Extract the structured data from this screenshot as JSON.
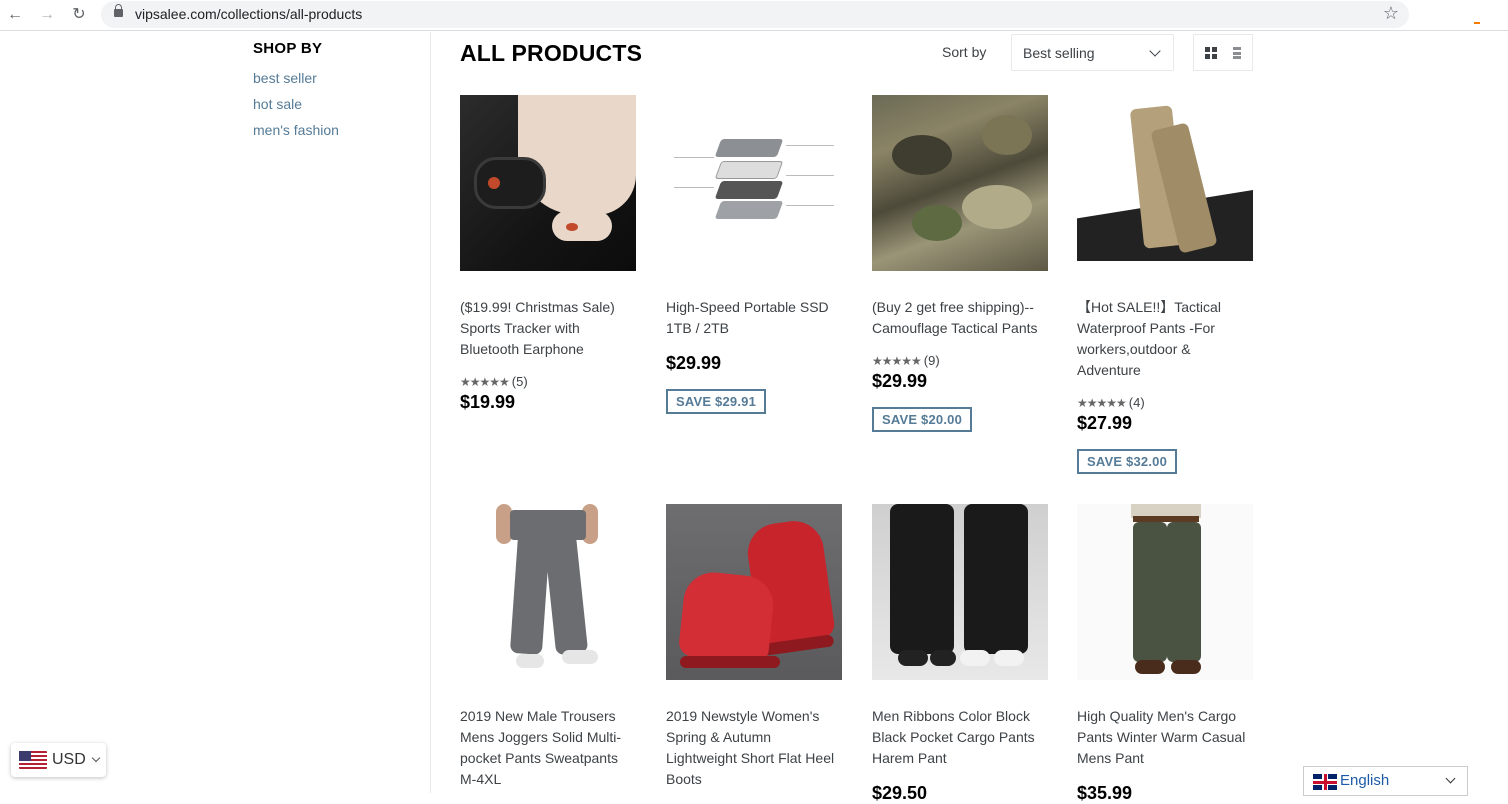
{
  "browser": {
    "url": "vipsalee.com/collections/all-products"
  },
  "sidebar": {
    "title": "SHOP BY",
    "links": [
      "best seller",
      "hot sale",
      "men's fashion"
    ]
  },
  "collection": {
    "title": "ALL PRODUCTS",
    "sort_label": "Sort by",
    "sort_value": "Best selling"
  },
  "products": [
    {
      "title": "($19.99! Christmas Sale) Sports Tracker with Bluetooth Earphone",
      "stars": "★★★★★",
      "reviews": "(5)",
      "price": "$19.99",
      "save": ""
    },
    {
      "title": "High-Speed Portable SSD 1TB / 2TB",
      "stars": "",
      "reviews": "",
      "price": "$29.99",
      "save": "SAVE $29.91"
    },
    {
      "title": "(Buy 2 get free shipping)--Camouflage Tactical Pants",
      "stars": "★★★★★",
      "reviews": "(9)",
      "price": "$29.99",
      "save": "SAVE $20.00"
    },
    {
      "title": "【Hot SALE!!】Tactical Waterproof Pants -For workers,outdoor & Adventure",
      "stars": "★★★★★",
      "reviews": "(4)",
      "price": "$27.99",
      "save": "SAVE $32.00"
    },
    {
      "title": "2019 New Male Trousers Mens Joggers Solid Multi-pocket Pants Sweatpants M-4XL",
      "stars": "",
      "reviews": "",
      "price": "",
      "save": ""
    },
    {
      "title": "2019 Newstyle Women's Spring & Autumn Lightweight Short Flat Heel Boots",
      "stars": "",
      "reviews": "",
      "price": "",
      "save": ""
    },
    {
      "title": "Men Ribbons Color Block Black Pocket Cargo Pants Harem Pant",
      "stars": "",
      "reviews": "",
      "price": "$29.50",
      "save": ""
    },
    {
      "title": "High Quality Men's Cargo Pants Winter Warm Casual Mens Pant",
      "stars": "",
      "reviews": "",
      "price": "$35.99",
      "save": ""
    }
  ],
  "currency": {
    "code": "USD"
  },
  "language": {
    "label": "English"
  },
  "colors": {
    "accent": "#557b97",
    "title": "#000000",
    "text": "#3d4246"
  }
}
